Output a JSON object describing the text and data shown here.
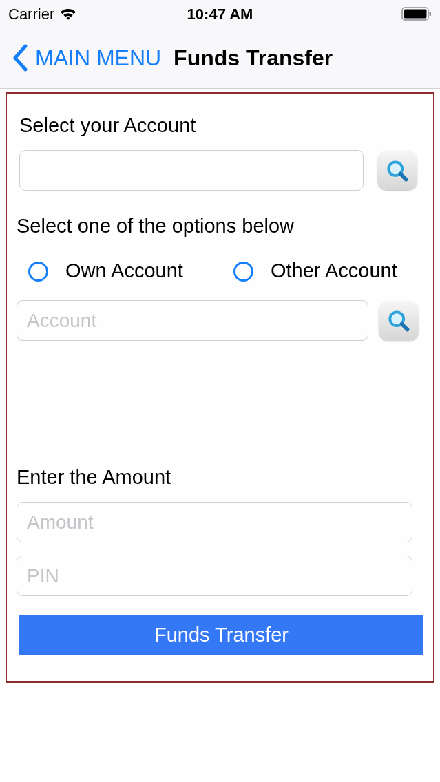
{
  "status_bar": {
    "carrier": "Carrier",
    "time": "10:47 AM"
  },
  "nav_bar": {
    "back_label": "MAIN MENU",
    "title": "Funds Transfer"
  },
  "account_lookup": {
    "label": "Select your Account"
  },
  "options": {
    "label": "Select one of the options below",
    "choices": [
      {
        "label": "Own Account",
        "selected": false
      },
      {
        "label": "Other Account",
        "selected": false
      }
    ]
  },
  "other_account_lookup": {
    "placeholder": "Account"
  },
  "amount_section": {
    "label": "Enter the Amount",
    "fields": [
      {
        "placeholder": "Amount"
      },
      {
        "placeholder": "PIN"
      }
    ]
  },
  "submit_button": {
    "label": "Funds Transfer"
  }
}
